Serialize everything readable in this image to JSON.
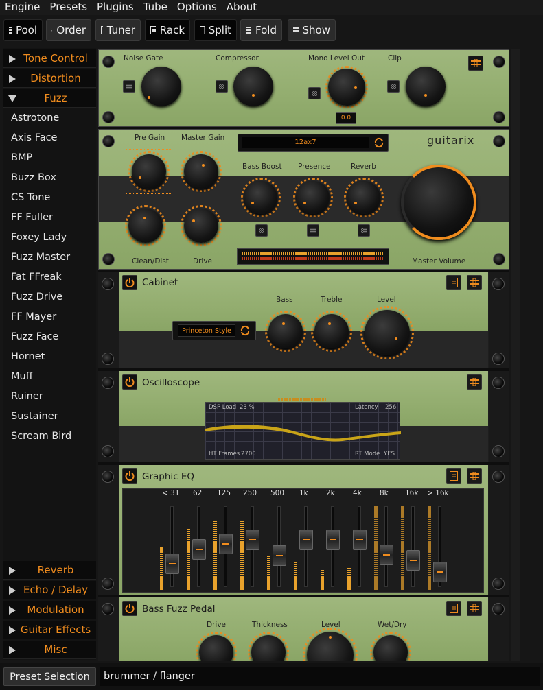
{
  "menu": [
    "Engine",
    "Presets",
    "Plugins",
    "Tube",
    "Options",
    "About"
  ],
  "toolbar": {
    "pool": "Pool",
    "order": "Order",
    "tuner": "Tuner",
    "rack": "Rack",
    "split": "Split",
    "fold": "Fold",
    "show": "Show"
  },
  "sidebar": {
    "cats_top": [
      "Tone Control",
      "Distortion",
      "Fuzz"
    ],
    "fuzz_items": [
      "Astrotone",
      "Axis Face",
      "BMP",
      "Buzz Box",
      "CS Tone",
      "FF Fuller",
      "Foxey Lady",
      "Fuzz Master",
      "Fat FFreak",
      "Fuzz Drive",
      "FF Mayer",
      "Fuzz Face",
      "Hornet",
      "Muff",
      "Ruiner",
      "Sustainer",
      "Scream Bird"
    ],
    "cats_bottom": [
      "Reverb",
      "Echo / Delay",
      "Modulation",
      "Guitar Effects",
      "Misc"
    ]
  },
  "mono": {
    "labels": [
      "Noise Gate",
      "Compressor",
      "Mono Level Out",
      "Clip"
    ],
    "readout": "0.0"
  },
  "amp": {
    "pre_gain": "Pre Gain",
    "master_gain": "Master Gain",
    "tube": "12ax7",
    "bass_boost": "Bass Boost",
    "presence": "Presence",
    "reverb": "Reverb",
    "clean_dist": "Clean/Dist",
    "drive": "Drive",
    "master_volume": "Master Volume",
    "logo": "guitarix"
  },
  "cabinet": {
    "title": "Cabinet",
    "bass": "Bass",
    "treble": "Treble",
    "level": "Level",
    "model": "Princeton Style"
  },
  "oscilloscope": {
    "title": "Oscilloscope",
    "dsp_load_label": "DSP Load",
    "dsp_load": "23 %",
    "latency_label": "Latency",
    "latency": "256",
    "frames_label": "HT Frames",
    "frames": "2700",
    "rt_label": "RT Mode",
    "rt": "YES"
  },
  "eq": {
    "title": "Graphic EQ",
    "bands": [
      "< 31",
      "62",
      "125",
      "250",
      "500",
      "1k",
      "2k",
      "4k",
      "8k",
      "16k",
      "> 16k"
    ]
  },
  "fuzzpedal": {
    "title": "Bass Fuzz Pedal",
    "drive": "Drive",
    "thickness": "Thickness",
    "level": "Level",
    "wetdry": "Wet/Dry"
  },
  "bottom": {
    "preset_button": "Preset Selection",
    "preset_name": "brummer / flanger"
  },
  "colors": {
    "accent": "#f08c1e",
    "panel_green": "#9cb47a"
  }
}
